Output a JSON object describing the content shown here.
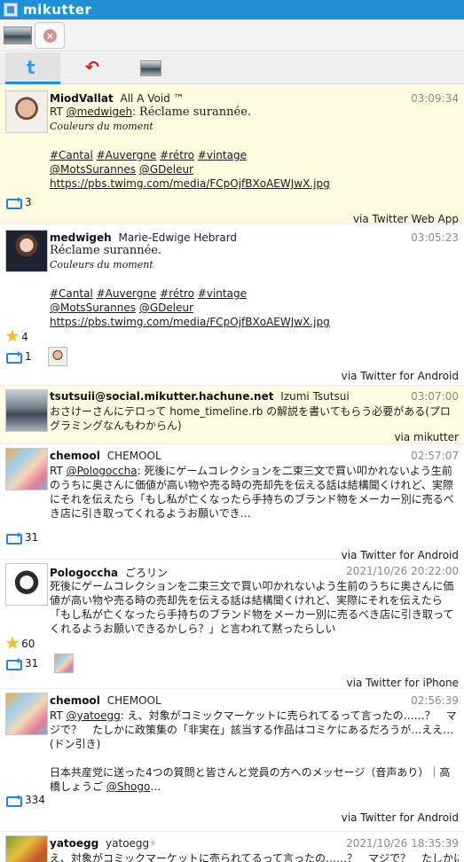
{
  "window": {
    "title": "mikutter"
  },
  "toolbar": {
    "post_button_symbol": "×"
  },
  "tabs": [
    {
      "icon": "twitter-bird-icon",
      "label": "t"
    },
    {
      "icon": "reply-arrow-icon",
      "label": "↶"
    },
    {
      "icon": "account-thumb-icon"
    }
  ],
  "tweets": [
    {
      "screen_name": "MiodVallat",
      "name": "All A Void ™",
      "time": "03:09:34",
      "body": [
        "RT ",
        "@medwigeh",
        ": ",
        "Réclame surannée."
      ],
      "line2": "Couleurs du moment",
      "hashtags": [
        "#Cantal",
        "#Auvergne",
        "#rétro",
        "#vintage"
      ],
      "mentions": [
        "@MotsSurannes",
        "@GDeleur"
      ],
      "url": "https://pbs.twimg.com/media/FCpOjfBXoAEWJwX.jpg",
      "retweets": "3",
      "via": "via Twitter Web App"
    },
    {
      "screen_name": "medwigeh",
      "name": "Marie-Edwige Hebrard",
      "time": "03:05:23",
      "line1": "Réclame surannée.",
      "line2": "Couleurs du moment",
      "hashtags": [
        "#Cantal",
        "#Auvergne",
        "#rétro",
        "#vintage"
      ],
      "mentions": [
        "@MotsSurannes",
        "@GDeleur"
      ],
      "url": "https://pbs.twimg.com/media/FCpOjfBXoAEWJwX.jpg",
      "favs": "4",
      "retweets": "1",
      "via": "via Twitter for Android"
    },
    {
      "screen_name": "tsutsuii@social.mikutter.hachune.net",
      "name": "Izumi Tsutsui",
      "time": "03:07:00",
      "text": "おさけーさんにテロって home_timeline.rb の解説を書いてもらう必要がある(プログラミングなんもわからん)",
      "via": "via mikutter"
    },
    {
      "screen_name": "chemool",
      "name": "CHEMOOL",
      "time": "02:57:07",
      "rt_prefix": "RT ",
      "rt_user": "@Pologoccha",
      "text": ": 死後にゲームコレクションを二束三文で買い叩かれないよう生前のうちに奥さんに価値が高い物や売る時の売却先を伝える話は結構聞くけれど、実際にそれを伝えたら「もし私が亡くなったら手持ちのブランド物をメーカー別に売るべき店に引き取ってくれるようお願いでき…",
      "retweets": "31",
      "via": "via Twitter for Android"
    },
    {
      "screen_name": "Pologoccha",
      "name": "ごろリン",
      "time": "2021/10/26 20:22:00",
      "text": "死後にゲームコレクションを二束三文で買い叩かれないよう生前のうちに奥さんに価値が高い物や売る時の売却先を伝える話は結構聞くけれど、実際にそれを伝えたら「もし私が亡くなったら手持ちのブランド物をメーカー別に売るべき店に引き取ってくれるようお願いできるかしら？」と言われて黙ったらしい",
      "favs": "60",
      "retweets": "31",
      "via": "via Twitter for iPhone"
    },
    {
      "screen_name": "chemool",
      "name": "CHEMOOL",
      "time": "02:56:39",
      "rt_prefix": "RT ",
      "rt_user": "@yatoegg",
      "text": ": え、対象がコミックマーケットに売られてるって言ったの……？　マジで？　たしかに政策集の「非実在」該当する作品はコミケにあるだろうが…ええ…(ドン引き)",
      "text2a": "日本共産党に送った4つの質問と皆さんと党員の方へのメッセージ（音声あり）｜高橋しょうご ",
      "text2_link": "@Shogo",
      "text2b": "…",
      "retweets": "334",
      "via": "via Twitter for Android"
    },
    {
      "screen_name": "yatoegg",
      "name": "yatoegg",
      "time": "2021/10/26 18:35:39",
      "text": "え、対象がコミックマーケットに売られてるって言ったの……？　マジで？　たしかに"
    }
  ]
}
